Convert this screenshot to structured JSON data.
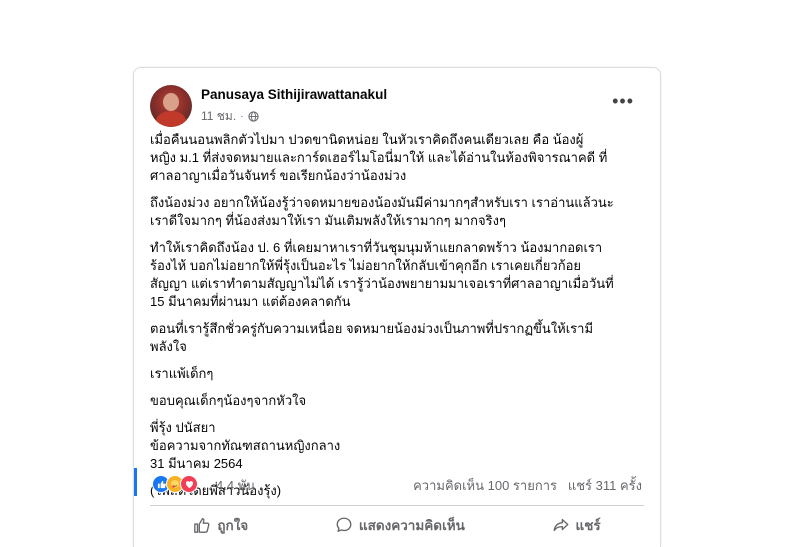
{
  "post": {
    "author": "Panusaya Sithijirawattanakul",
    "time": "11 ชม.",
    "time_separator": "·",
    "privacy_icon": "globe-icon",
    "more_icon": "more-icon",
    "paragraphs": [
      "เมื่อคืนนอนพลิกตัวไปมา ปวดขานิดหน่อย ในหัวเราคิดถึงคนเดียวเลย คือ น้องผู้\nหญิง ม.1 ที่ส่งจดหมายและการ์ดเฮอร์ไมโอนี่มาให้ และได้อ่านในห้องพิจารณาคดี ที่\nศาลอาญาเมื่อวันจันทร์ ขอเรียกน้องว่าน้องม่วง",
      "ถึงน้องม่วง อยากให้น้องรู้ว่าจดหมายของน้องมันมีค่ามากๆสำหรับเรา เราอ่านแล้วนะ\nเราดีใจมากๆ ที่น้องส่งมาให้เรา มันเติมพลังให้เรามากๆ มากจริงๆ",
      "ทำให้เราคิดถึงน้อง ป. 6 ที่เคยมาหาเราที่วันชุมนุมห้าแยกลาดพร้าว น้องมากอดเรา\nร้องไห้ บอกไม่อยากให้พี่รุ้งเป็นอะไร ไม่อยากให้กลับเข้าคุกอีก เราเคยเกี่ยวก้อย\nสัญญา แต่เราทำตามสัญญาไม่ได้ เรารู้ว่าน้องพยายามมาเจอเราที่ศาลอาญาเมื่อวันที่\n15 มีนาคมที่ผ่านมา แต่ต้องคลาดกัน",
      "ตอนที่เรารู้สึกชั่วครู่กับความเหนื่อย จดหมายน้องม่วงเป็นภาพที่ปรากฏขึ้นให้เรามี\nพลังใจ",
      "เราแพ้เด็กๆ",
      "ขอบคุณเด็กๆน้องๆจากหัวใจ",
      "พี่รุ้ง ปนัสยา\nข้อความจากทัณฑสถานหญิงกลาง\n31 มีนาคม 2564",
      "(โพสต์โดยพี่สาวน้องรุ้ง)"
    ]
  },
  "reactions": {
    "icons": [
      "like-icon",
      "care-icon",
      "love-icon"
    ],
    "count": "4.4 พัน",
    "comments": "ความคิดเห็น 100 รายการ",
    "shares": "แชร์ 311 ครั้ง"
  },
  "actions": {
    "like": "ถูกใจ",
    "comment": "แสดงความคิดเห็น",
    "share": "แชร์"
  },
  "colors": {
    "accent": "#1877f2",
    "love": "#f33e58",
    "care": "#f7b125",
    "secondary_text": "#65676b"
  }
}
